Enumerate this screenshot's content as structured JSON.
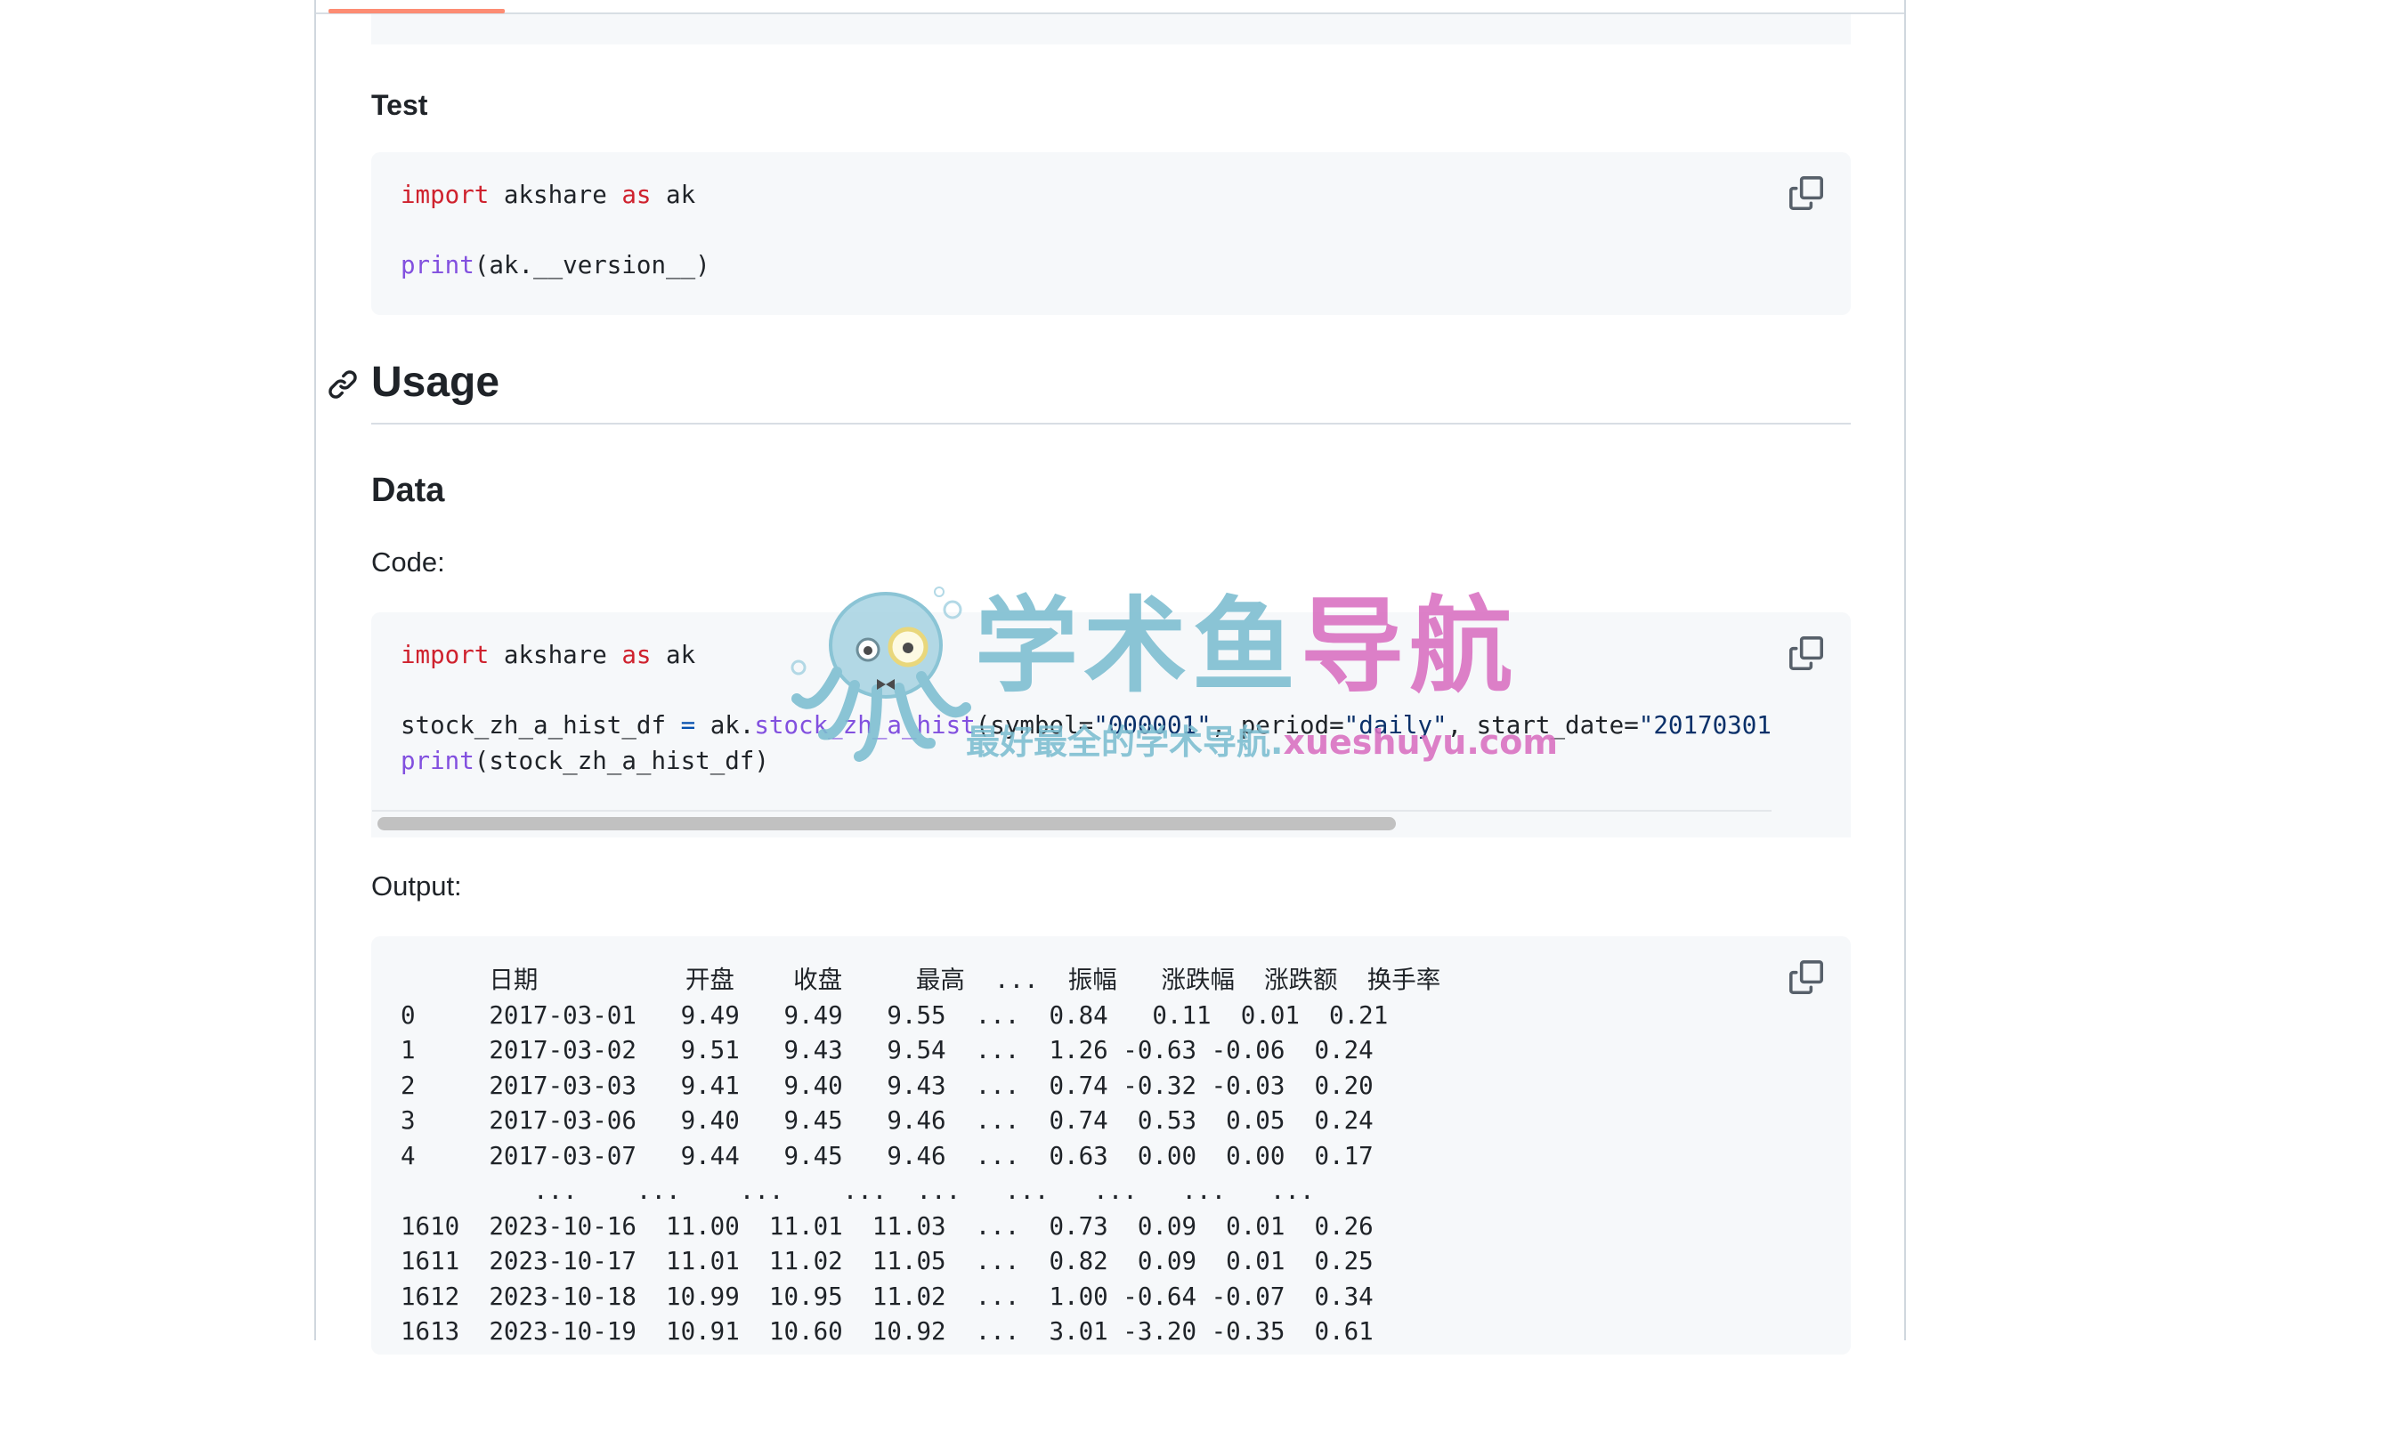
{
  "colors": {
    "tab_active": "#fd8c73",
    "code_bg": "#f6f8fa",
    "keyword": "#cf222e",
    "function": "#8250df",
    "string": "#0a3069",
    "watermark_blue": "#7cbdd0",
    "watermark_pink": "#d96fc1"
  },
  "icons": {
    "anchor": "link-icon",
    "copy": "copy-icon"
  },
  "sections": {
    "test_heading": "Test",
    "usage_heading": "Usage",
    "data_heading": "Data",
    "code_label": "Code:",
    "output_label": "Output:"
  },
  "code_test": {
    "line1_kw1": "import",
    "line1_mid": " akshare ",
    "line1_kw2": "as",
    "line1_end": " ak",
    "line2_fn": "print",
    "line2_rest": "(ak.__version__)"
  },
  "code_data": {
    "line1_kw1": "import",
    "line1_mid": " akshare ",
    "line1_kw2": "as",
    "line1_end": " ak",
    "line2_var": "stock_zh_a_hist_df ",
    "line2_eq": "=",
    "line2_mod": " ak.",
    "line2_fn": "stock_zh_a_hist",
    "line2_p1": "(symbol=",
    "line2_s1": "\"000001\"",
    "line2_p2": ", period=",
    "line2_s2": "\"daily\"",
    "line2_p3": ", start_date=",
    "line2_s3": "\"20170301\"",
    "line3_fn": "print",
    "line3_rest": "(stock_zh_a_hist_df)"
  },
  "output": {
    "lines": [
      "      日期          开盘    收盘     最高  ...  振幅   涨跌幅  涨跌额  换手率",
      "0     2017-03-01   9.49   9.49   9.55  ...  0.84   0.11  0.01  0.21",
      "1     2017-03-02   9.51   9.43   9.54  ...  1.26 -0.63 -0.06  0.24",
      "2     2017-03-03   9.41   9.40   9.43  ...  0.74 -0.32 -0.03  0.20",
      "3     2017-03-06   9.40   9.45   9.46  ...  0.74  0.53  0.05  0.24",
      "4     2017-03-07   9.44   9.45   9.46  ...  0.63  0.00  0.00  0.17",
      "         ...    ...    ...    ...  ...   ...   ...   ...   ...",
      "1610  2023-10-16  11.00  11.01  11.03  ...  0.73  0.09  0.01  0.26",
      "1611  2023-10-17  11.01  11.02  11.05  ...  0.82  0.09  0.01  0.25",
      "1612  2023-10-18  10.99  10.95  11.02  ...  1.00 -0.64 -0.07  0.34",
      "1613  2023-10-19  10.91  10.60  10.92  ...  3.01 -3.20 -0.35  0.61"
    ]
  },
  "watermark": {
    "title_part1": "学术鱼",
    "title_part2": "导航",
    "subtitle_part1": "最好最全的学术导航.",
    "subtitle_part2": "xueshuyu.com"
  }
}
